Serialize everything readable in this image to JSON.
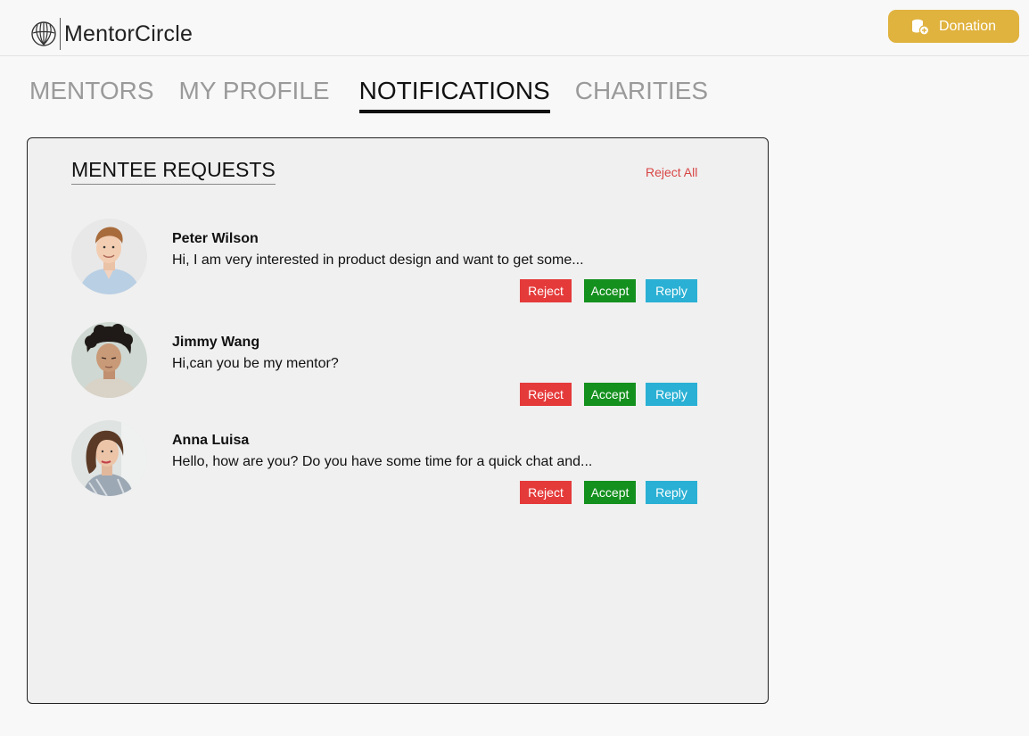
{
  "header": {
    "brand": "MentorCircle",
    "donate_label": "Donation",
    "brand_color": "#e0b23e"
  },
  "tabs": [
    {
      "label": "MENTORS",
      "active": false
    },
    {
      "label": "MY PROFILE",
      "active": false
    },
    {
      "label": "NOTIFICATIONS",
      "active": true
    },
    {
      "label": "CHARITIES",
      "active": false
    }
  ],
  "panel": {
    "title": "MENTEE REQUESTS",
    "reject_all_label": "Reject All"
  },
  "requests": [
    {
      "name": "Peter Wilson",
      "message": "Hi, I am very interested in product design and want to get some...",
      "reject_label": "Reject",
      "accept_label": "Accept",
      "reply_label": "Reply"
    },
    {
      "name": "Jimmy Wang",
      "message": "Hi,can you be my mentor?",
      "reject_label": "Reject",
      "accept_label": "Accept",
      "reply_label": "Reply"
    },
    {
      "name": "Anna Luisa",
      "message": "Hello, how are you? Do you have some time for a quick chat and...",
      "reject_label": "Reject",
      "accept_label": "Accept",
      "reply_label": "Reply"
    }
  ],
  "colors": {
    "reject": "#e53a3a",
    "accept": "#14901e",
    "reply": "#2ab0d4",
    "reject_all": "#d94545"
  }
}
